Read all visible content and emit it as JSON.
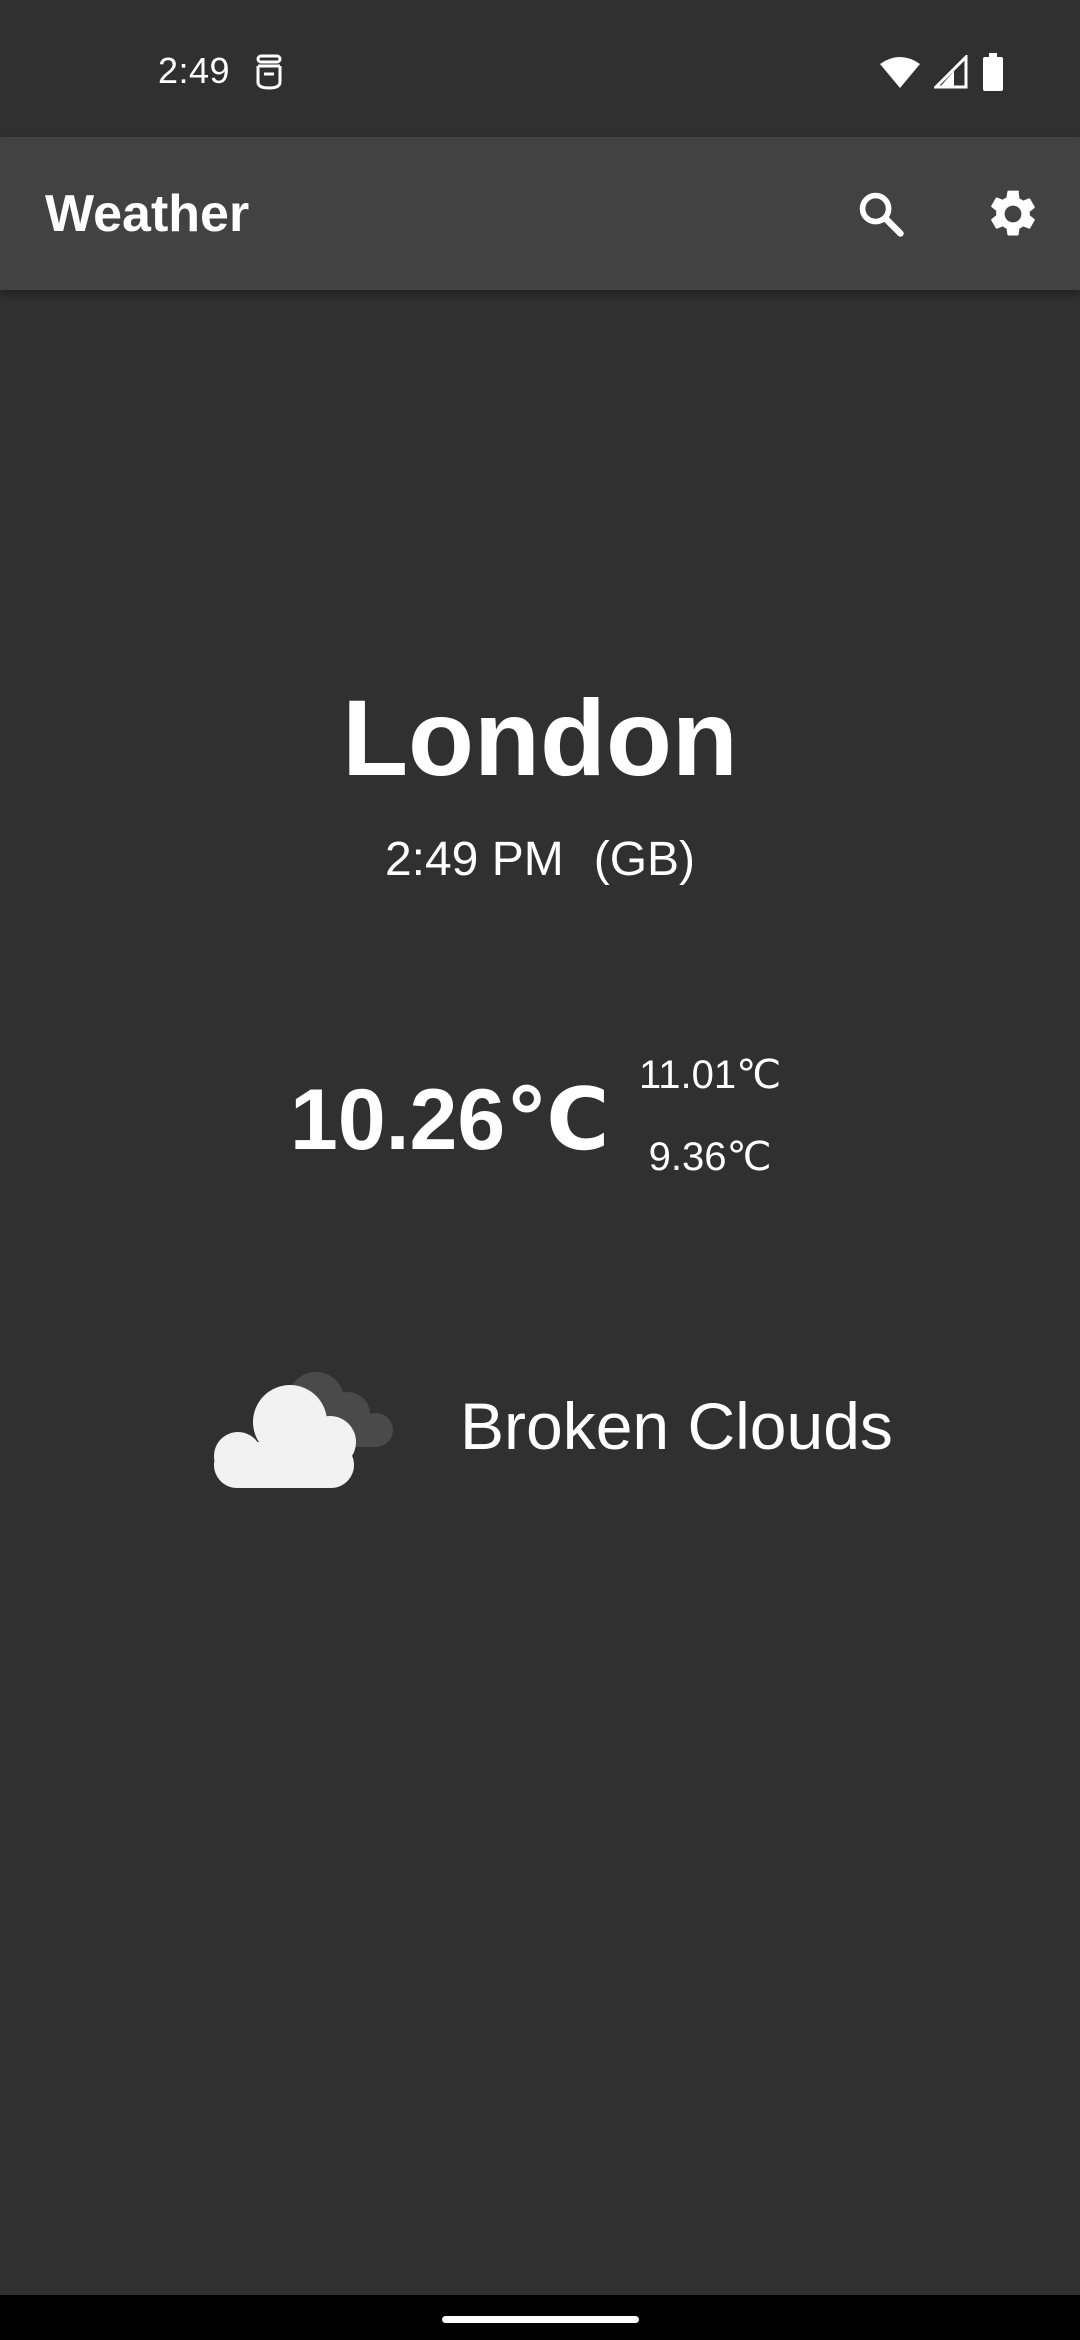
{
  "status_bar": {
    "time": "2:49",
    "icons": [
      "app-notification-icon",
      "wifi-icon",
      "signal-icon",
      "battery-icon"
    ]
  },
  "app_bar": {
    "title": "Weather",
    "actions": [
      "search-icon",
      "settings-gear-icon"
    ]
  },
  "location": {
    "city": "London",
    "local_time": "2:49 PM",
    "country": "(GB)"
  },
  "temperature": {
    "current": "10.26℃",
    "max": "11.01℃",
    "min": "9.36℃"
  },
  "condition": {
    "icon": "broken-clouds-icon",
    "description": "Broken Clouds"
  },
  "colors": {
    "background": "#303030",
    "app_bar": "#424242",
    "text": "#ffffff",
    "cloud_front": "#f2f2f2",
    "cloud_back": "#4a4a4a"
  }
}
